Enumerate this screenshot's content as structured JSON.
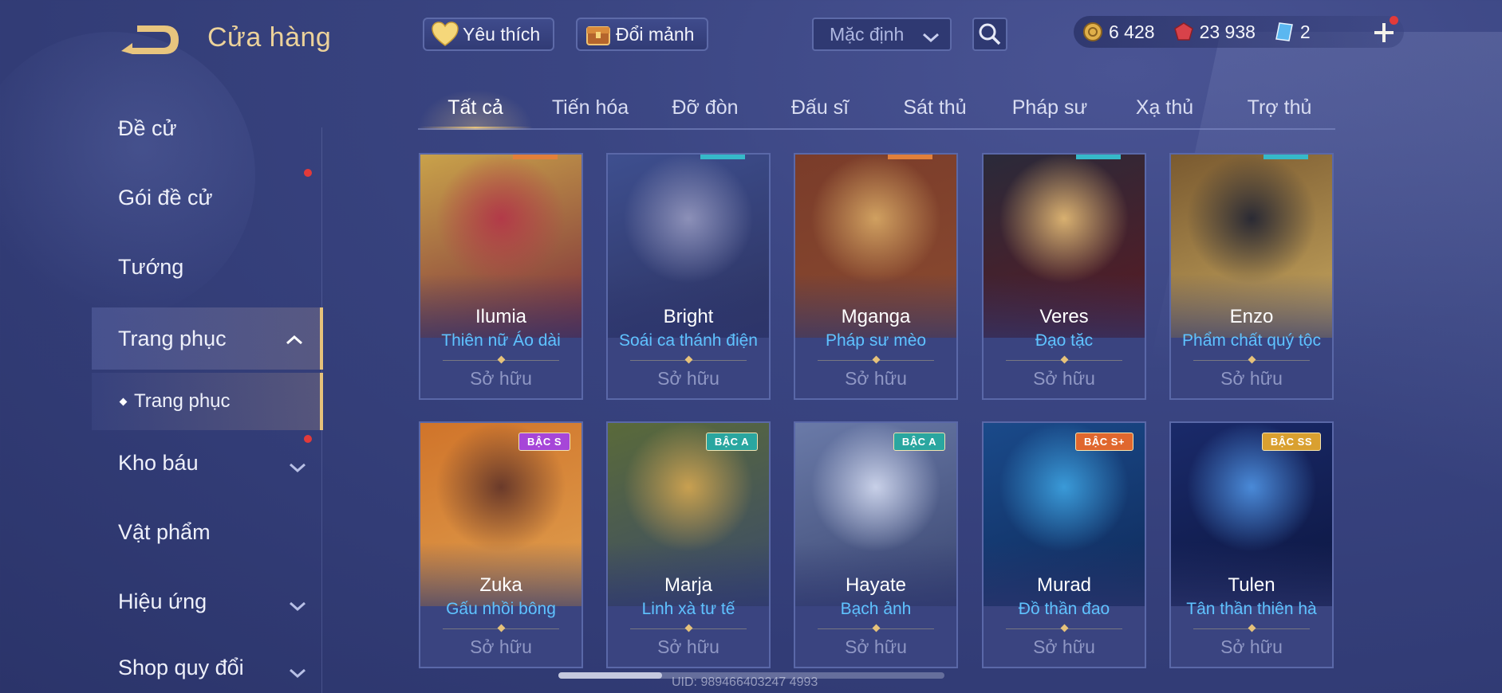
{
  "header": {
    "title": "Cửa hàng",
    "favorites_label": "Yêu thích",
    "exchange_label": "Đổi mảnh",
    "sort_value": "Mặc định",
    "currencies": [
      {
        "icon": "gold-coin-icon",
        "value": "6 428"
      },
      {
        "icon": "red-gem-icon",
        "value": "23 938"
      },
      {
        "icon": "blue-card-icon",
        "value": "2"
      }
    ]
  },
  "sidebar": {
    "items": [
      {
        "label": "Đề cử"
      },
      {
        "label": "Gói đề cử"
      },
      {
        "label": "Tướng"
      },
      {
        "label": "Trang phục"
      },
      {
        "label": "Trang phục"
      },
      {
        "label": "Kho báu"
      },
      {
        "label": "Vật phẩm"
      },
      {
        "label": "Hiệu ứng"
      },
      {
        "label": "Shop quy đổi"
      }
    ]
  },
  "tabs": [
    "Tất cả",
    "Tiến hóa",
    "Đỡ đòn",
    "Đấu sĩ",
    "Sát thủ",
    "Pháp sư",
    "Xạ thủ",
    "Trợ thủ"
  ],
  "cards": [
    {
      "hero": "Ilumia",
      "skin": "Thiên nữ Áo dài",
      "status": "Sở hữu",
      "tier": "",
      "accent": "#e2803a"
    },
    {
      "hero": "Bright",
      "skin": "Soái ca thánh điện",
      "status": "Sở hữu",
      "tier": "",
      "accent": "#36b9c9"
    },
    {
      "hero": "Mganga",
      "skin": "Pháp sư mèo",
      "status": "Sở hữu",
      "tier": "",
      "accent": "#e2803a"
    },
    {
      "hero": "Veres",
      "skin": "Đạo tặc",
      "status": "Sở hữu",
      "tier": "",
      "accent": "#36b9c9"
    },
    {
      "hero": "Enzo",
      "skin": "Phẩm chất quý tộc",
      "status": "Sở hữu",
      "tier": "",
      "accent": "#36b9c9"
    },
    {
      "hero": "Zuka",
      "skin": "Gấu nhồi bông",
      "status": "Sở hữu",
      "tier": "BẬC S",
      "accent": "#a646d8"
    },
    {
      "hero": "Marja",
      "skin": "Linh xà tư tế",
      "status": "Sở hữu",
      "tier": "BẬC A",
      "accent": "#2aa6a0"
    },
    {
      "hero": "Hayate",
      "skin": "Bạch ảnh",
      "status": "Sở hữu",
      "tier": "BẬC A",
      "accent": "#2aa6a0"
    },
    {
      "hero": "Murad",
      "skin": "Đồ thần đao",
      "status": "Sở hữu",
      "tier": "BẬC S+",
      "accent": "#e0672e"
    },
    {
      "hero": "Tulen",
      "skin": "Tân thần thiên hà",
      "status": "Sở hữu",
      "tier": "BẬC SS",
      "accent": "#d9a030"
    }
  ],
  "footer": {
    "uid": "UID: 989466403247 4993"
  }
}
